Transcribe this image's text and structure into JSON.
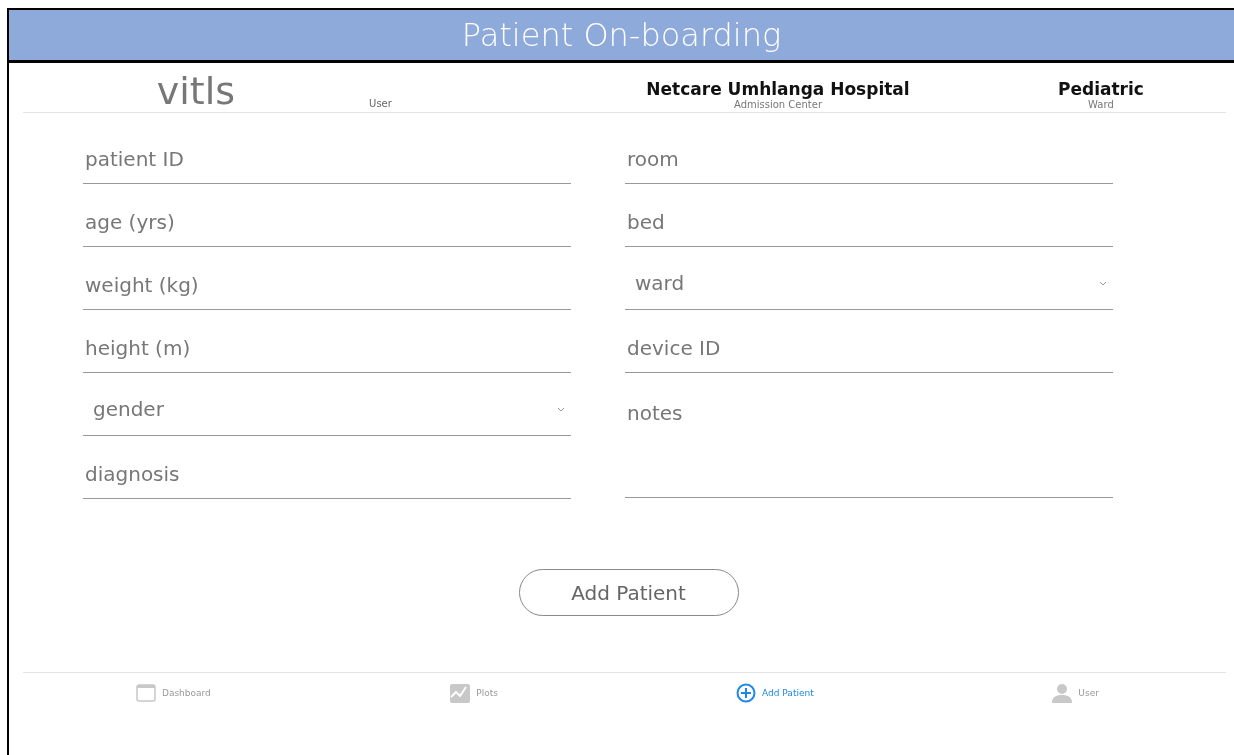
{
  "window": {
    "title": "Patient On-boarding"
  },
  "header": {
    "logo": "vitls",
    "user_label": "User",
    "hospital": {
      "name": "Netcare Umhlanga Hospital",
      "subtitle": "Admission Center"
    },
    "ward": {
      "name": "Pediatric",
      "subtitle": "Ward"
    }
  },
  "form": {
    "left": [
      {
        "kind": "text",
        "placeholder": "patient ID"
      },
      {
        "kind": "text",
        "placeholder": "age (yrs)"
      },
      {
        "kind": "text",
        "placeholder": "weight (kg)"
      },
      {
        "kind": "text",
        "placeholder": "height (m)"
      },
      {
        "kind": "select",
        "placeholder": "gender"
      },
      {
        "kind": "text",
        "placeholder": "diagnosis"
      }
    ],
    "right": [
      {
        "kind": "text",
        "placeholder": "room"
      },
      {
        "kind": "text",
        "placeholder": "bed"
      },
      {
        "kind": "select",
        "placeholder": "ward"
      },
      {
        "kind": "text",
        "placeholder": "device ID"
      },
      {
        "kind": "textarea",
        "placeholder": "notes"
      }
    ],
    "submit": "Add Patient"
  },
  "nav": [
    {
      "kind": "dashboard",
      "label": "Dashboard",
      "selected": false
    },
    {
      "kind": "plots",
      "label": "Plots",
      "selected": false
    },
    {
      "kind": "add",
      "label": "Add Patient",
      "selected": true
    },
    {
      "kind": "user",
      "label": "User",
      "selected": false
    }
  ]
}
